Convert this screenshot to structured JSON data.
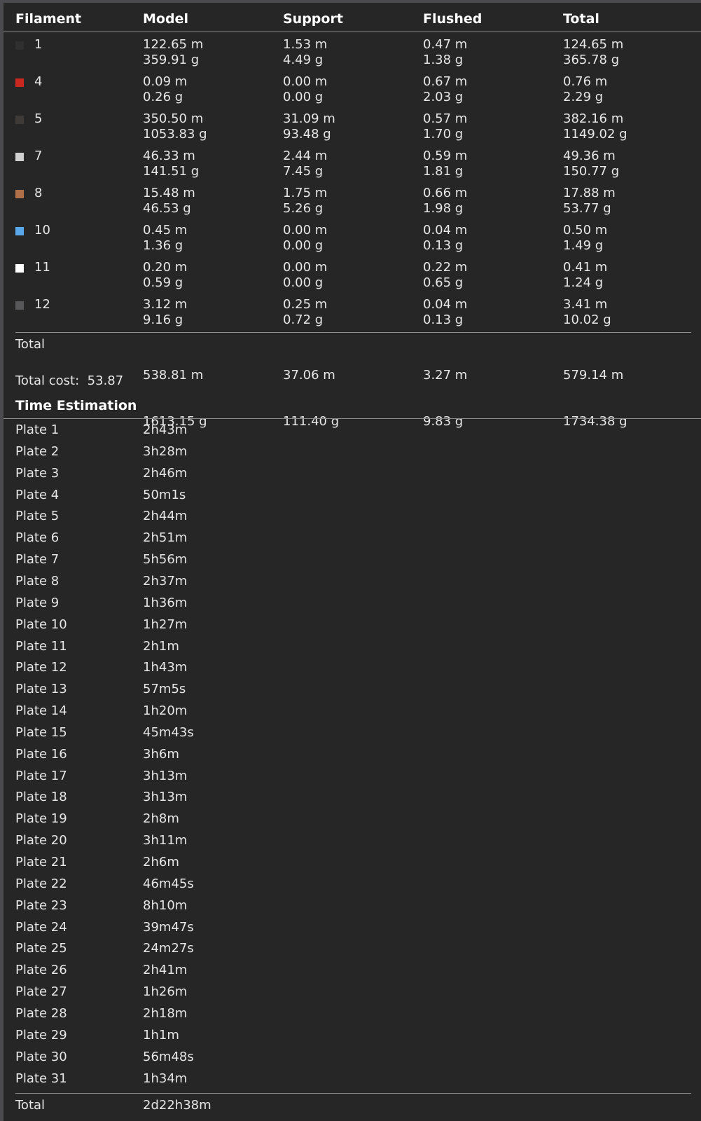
{
  "columns": {
    "filament": "Filament",
    "model": "Model",
    "support": "Support",
    "flushed": "Flushed",
    "total": "Total"
  },
  "filaments": [
    {
      "id": "1",
      "color": "#2f2f30",
      "model_len": "122.65 m",
      "model_wt": "359.91 g",
      "support_len": "1.53 m",
      "support_wt": "4.49 g",
      "flushed_len": "0.47 m",
      "flushed_wt": "1.38 g",
      "total_len": "124.65 m",
      "total_wt": "365.78 g"
    },
    {
      "id": "4",
      "color": "#c8281e",
      "model_len": "0.09 m",
      "model_wt": "0.26 g",
      "support_len": "0.00 m",
      "support_wt": "0.00 g",
      "flushed_len": "0.67 m",
      "flushed_wt": "2.03 g",
      "total_len": "0.76 m",
      "total_wt": "2.29 g"
    },
    {
      "id": "5",
      "color": "#3e3a38",
      "model_len": "350.50 m",
      "model_wt": "1053.83 g",
      "support_len": "31.09 m",
      "support_wt": "93.48 g",
      "flushed_len": "0.57 m",
      "flushed_wt": "1.70 g",
      "total_len": "382.16 m",
      "total_wt": "1149.02 g"
    },
    {
      "id": "7",
      "color": "#cfcfcf",
      "model_len": "46.33 m",
      "model_wt": "141.51 g",
      "support_len": "2.44 m",
      "support_wt": "7.45 g",
      "flushed_len": "0.59 m",
      "flushed_wt": "1.81 g",
      "total_len": "49.36 m",
      "total_wt": "150.77 g"
    },
    {
      "id": "8",
      "color": "#b0704a",
      "model_len": "15.48 m",
      "model_wt": "46.53 g",
      "support_len": "1.75 m",
      "support_wt": "5.26 g",
      "flushed_len": "0.66 m",
      "flushed_wt": "1.98 g",
      "total_len": "17.88 m",
      "total_wt": "53.77 g"
    },
    {
      "id": "10",
      "color": "#5aa8ec",
      "model_len": "0.45 m",
      "model_wt": "1.36 g",
      "support_len": "0.00 m",
      "support_wt": "0.00 g",
      "flushed_len": "0.04 m",
      "flushed_wt": "0.13 g",
      "total_len": "0.50 m",
      "total_wt": "1.49 g"
    },
    {
      "id": "11",
      "color": "#ffffff",
      "model_len": "0.20 m",
      "model_wt": "0.59 g",
      "support_len": "0.00 m",
      "support_wt": "0.00 g",
      "flushed_len": "0.22 m",
      "flushed_wt": "0.65 g",
      "total_len": "0.41 m",
      "total_wt": "1.24 g"
    },
    {
      "id": "12",
      "color": "#58585a",
      "model_len": "3.12 m",
      "model_wt": "9.16 g",
      "support_len": "0.25 m",
      "support_wt": "0.72 g",
      "flushed_len": "0.04 m",
      "flushed_wt": "0.13 g",
      "total_len": "3.41 m",
      "total_wt": "10.02 g"
    }
  ],
  "totals": {
    "label": "Total",
    "model_len": "538.81 m",
    "model_wt": "1613.15 g",
    "support_len": "37.06 m",
    "support_wt": "111.40 g",
    "flushed_len": "3.27 m",
    "flushed_wt": "9.83 g",
    "total_len": "579.14 m",
    "total_wt": "1734.38 g"
  },
  "cost": {
    "label": "Total cost:",
    "value": "53.87"
  },
  "time": {
    "title": "Time Estimation",
    "plates": [
      {
        "name": "Plate 1",
        "time": "2h43m"
      },
      {
        "name": "Plate 2",
        "time": "3h28m"
      },
      {
        "name": "Plate 3",
        "time": "2h46m"
      },
      {
        "name": "Plate 4",
        "time": "50m1s"
      },
      {
        "name": "Plate 5",
        "time": "2h44m"
      },
      {
        "name": "Plate 6",
        "time": "2h51m"
      },
      {
        "name": "Plate 7",
        "time": "5h56m"
      },
      {
        "name": "Plate 8",
        "time": "2h37m"
      },
      {
        "name": "Plate 9",
        "time": "1h36m"
      },
      {
        "name": "Plate 10",
        "time": "1h27m"
      },
      {
        "name": "Plate 11",
        "time": "2h1m"
      },
      {
        "name": "Plate 12",
        "time": "1h43m"
      },
      {
        "name": "Plate 13",
        "time": "57m5s"
      },
      {
        "name": "Plate 14",
        "time": "1h20m"
      },
      {
        "name": "Plate 15",
        "time": "45m43s"
      },
      {
        "name": "Plate 16",
        "time": "3h6m"
      },
      {
        "name": "Plate 17",
        "time": "3h13m"
      },
      {
        "name": "Plate 18",
        "time": "3h13m"
      },
      {
        "name": "Plate 19",
        "time": "2h8m"
      },
      {
        "name": "Plate 20",
        "time": "3h11m"
      },
      {
        "name": "Plate 21",
        "time": "2h6m"
      },
      {
        "name": "Plate 22",
        "time": "46m45s"
      },
      {
        "name": "Plate 23",
        "time": "8h10m"
      },
      {
        "name": "Plate 24",
        "time": "39m47s"
      },
      {
        "name": "Plate 25",
        "time": "24m27s"
      },
      {
        "name": "Plate 26",
        "time": "2h41m"
      },
      {
        "name": "Plate 27",
        "time": "1h26m"
      },
      {
        "name": "Plate 28",
        "time": "2h18m"
      },
      {
        "name": "Plate 29",
        "time": "1h1m"
      },
      {
        "name": "Plate 30",
        "time": "56m48s"
      },
      {
        "name": "Plate 31",
        "time": "1h34m"
      }
    ],
    "total_label": "Total",
    "total_value": "2d22h38m"
  }
}
